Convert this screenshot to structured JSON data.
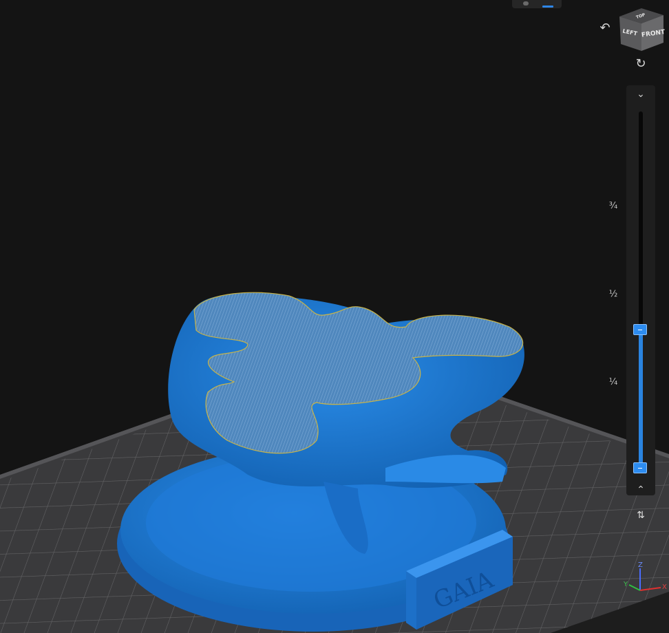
{
  "view_cube": {
    "top": "TOP",
    "left": "LEFT",
    "front": "FRONT"
  },
  "layer_slider": {
    "marks": [
      "¾",
      "½",
      "¼"
    ],
    "range_lower_fraction": 0.0,
    "range_upper_fraction": 0.39
  },
  "model": {
    "base_label": "GAIA"
  },
  "axes": {
    "x": "X",
    "y": "Y",
    "z": "Z"
  },
  "colors": {
    "background": "#141414",
    "bed": "#3c3c3e",
    "model": "#1f78d1",
    "slice_cap": "#5d8ebf",
    "accent": "#2d8cf0"
  }
}
